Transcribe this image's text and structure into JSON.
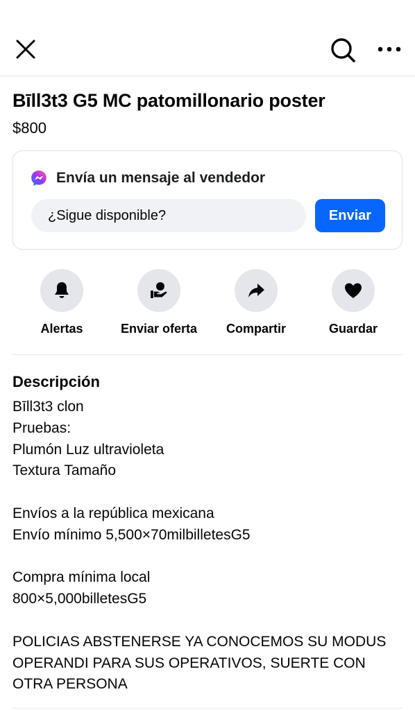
{
  "header": {
    "close_icon": "close-icon",
    "search_icon": "search-icon",
    "more_icon": "more-dots-icon"
  },
  "listing": {
    "title": "Bīll3t3 G5 MC patomillonario poster",
    "price": "$800"
  },
  "message_card": {
    "heading": "Envía un mensaje al vendedor",
    "input_value": "¿Sigue disponible?",
    "send_label": "Enviar",
    "accent_color": "#0866ff"
  },
  "actions": [
    {
      "label": "Alertas",
      "icon": "bell-icon"
    },
    {
      "label": "Enviar oferta",
      "icon": "offer-icon"
    },
    {
      "label": "Compartir",
      "icon": "share-icon"
    },
    {
      "label": "Guardar",
      "icon": "heart-icon"
    }
  ],
  "description": {
    "heading": "Descripción",
    "lines": [
      "Bīll3t3 clon",
      "Pruebas:",
      "Plumón Luz ultravioleta",
      "Textura Tamaño",
      "",
      "Envíos a la república mexicana",
      "Envío mínimo 5,500×70milbilletesG5",
      "",
      "Compra mínima local",
      "800×5,000billetesG5",
      "",
      "POLICIAS ABSTENERSE YA CONOCEMOS SU MODUS",
      "OPERANDI PARA SUS OPERATIVOS, SUERTE CON",
      "OTRA PERSONA"
    ]
  }
}
